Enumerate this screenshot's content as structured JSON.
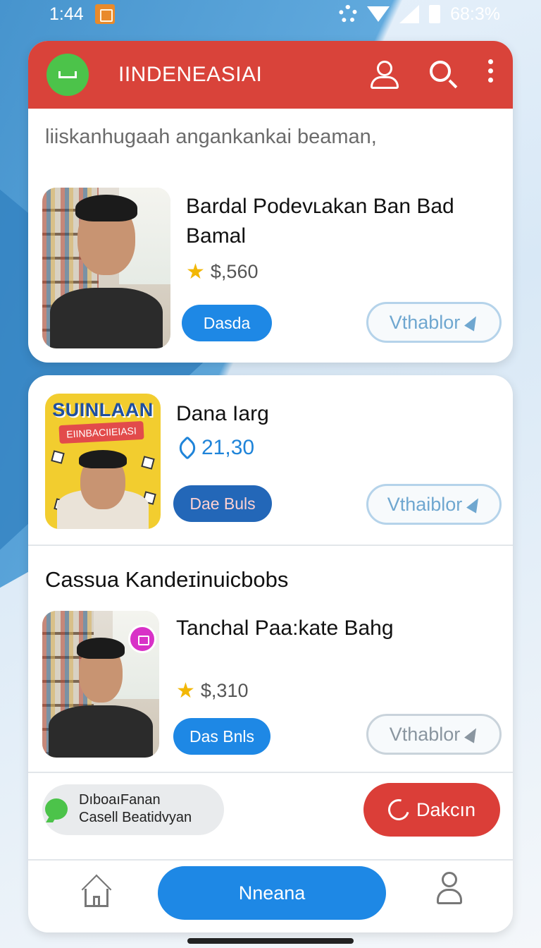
{
  "status_bar": {
    "time": "1:44",
    "battery": "68:3%"
  },
  "app_bar": {
    "title": "IINDENEASIAI"
  },
  "card1": {
    "subtitle": "liiskanhugaah angankankai beaman,",
    "item": {
      "title": "Bardal Podevʟakan Ban Bad Bamal",
      "rating": "$,560",
      "primary_label": "Dasda",
      "secondary_label": "Vthablor"
    }
  },
  "card2": {
    "item1": {
      "poster_title": "SUINLAAN",
      "poster_banner": "EIINBACIIEIASI",
      "title": "Dana Iarg",
      "count": "21,30",
      "primary_label": "Dae Buls",
      "secondary_label": "Vthaiblor"
    },
    "section_title": "Cassua Kandeɪinuicbobs",
    "item2": {
      "title": "Tanchal Paa:kate Bahg",
      "rating": "$,310",
      "primary_label": "Das Bnls",
      "secondary_label": "Vthablor"
    },
    "chat": {
      "line1": "DıboaıFanan",
      "line2": "Casell Beatidvyan"
    },
    "red_button": "Dakcın",
    "nav_main": "Nneana"
  },
  "colors": {
    "app_bar": "#d9433a",
    "primary": "#1e88e5",
    "red_button": "#db3e38",
    "logo_green": "#4cc34a",
    "star": "#f2b705"
  },
  "icons": {
    "status": [
      "notification-icon",
      "settings-icon",
      "wifi-icon",
      "signal-icon",
      "battery-icon"
    ],
    "app_bar": [
      "app-logo-icon",
      "user-icon",
      "search-icon",
      "more-vert-icon"
    ],
    "nav": [
      "home-icon",
      "profile-icon"
    ]
  }
}
